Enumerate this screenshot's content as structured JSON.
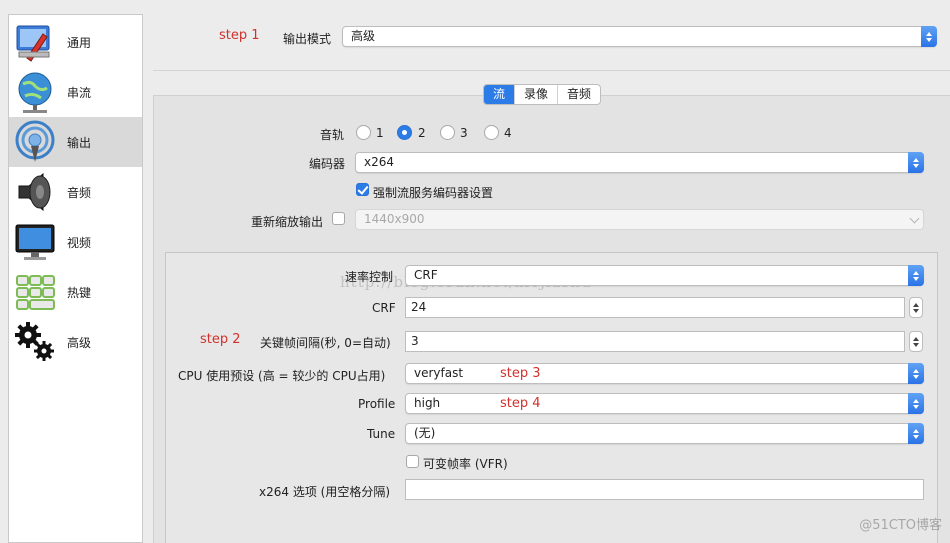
{
  "sidebar": {
    "items": [
      {
        "label": "通用",
        "icon": "general-settings-icon"
      },
      {
        "label": "串流",
        "icon": "stream-globe-icon"
      },
      {
        "label": "输出",
        "icon": "output-broadcast-icon",
        "selected": true
      },
      {
        "label": "音频",
        "icon": "speaker-icon"
      },
      {
        "label": "视频",
        "icon": "monitor-icon"
      },
      {
        "label": "热键",
        "icon": "keyboard-icon"
      },
      {
        "label": "高级",
        "icon": "gears-icon"
      }
    ]
  },
  "annotations": {
    "step1": "step 1",
    "step2": "step 2",
    "step3": "step 3",
    "step4": "step 4"
  },
  "output_mode": {
    "label": "输出模式",
    "value": "高级"
  },
  "tabs": [
    {
      "label": "流",
      "active": true
    },
    {
      "label": "录像"
    },
    {
      "label": "音频"
    }
  ],
  "audio_track": {
    "label": "音轨",
    "options": [
      "1",
      "2",
      "3",
      "4"
    ],
    "selected": "2"
  },
  "encoder": {
    "label": "编码器",
    "value": "x264"
  },
  "enforce_service": {
    "label": "强制流服务编码器设置",
    "checked": true
  },
  "rescale": {
    "label": "重新缩放输出",
    "checked": false,
    "value": "1440x900"
  },
  "rate_control": {
    "label": "速率控制",
    "value": "CRF"
  },
  "crf": {
    "label": "CRF",
    "value": "24"
  },
  "keyframe": {
    "label": "关键帧间隔(秒, 0=自动)",
    "value": "3"
  },
  "cpu_preset": {
    "label": "CPU 使用预设 (高 = 较少的 CPU占用)",
    "value": "veryfast"
  },
  "profile": {
    "label": "Profile",
    "value": "high"
  },
  "tune": {
    "label": "Tune",
    "value": "(无)"
  },
  "vfr": {
    "label": "可变帧率 (VFR)",
    "checked": false
  },
  "x264_options": {
    "label": "x264 选项 (用空格分隔)",
    "value": ""
  },
  "watermark": "http://blog.csdn.net/xiejiashu",
  "corner_watermark": "@51CTO博客",
  "colors": {
    "accent": "#2c7ce8",
    "annotation": "#d0312d"
  }
}
